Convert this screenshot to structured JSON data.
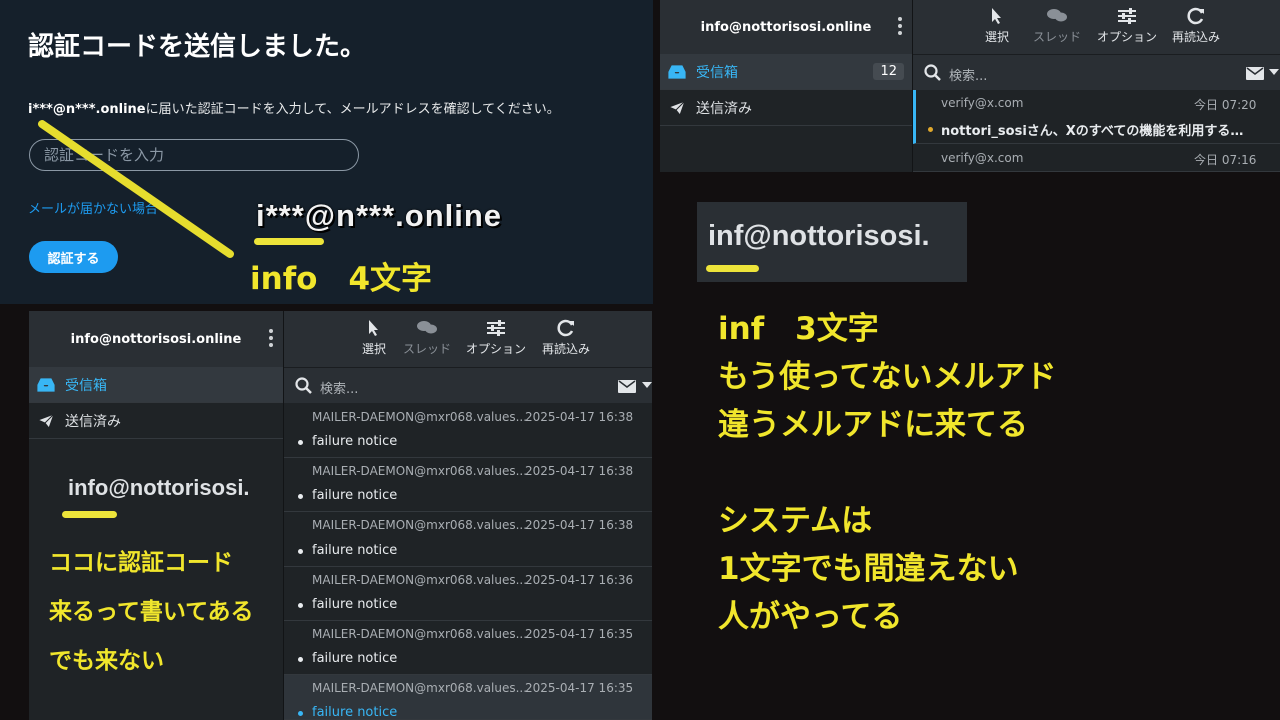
{
  "verify": {
    "title": "認証コードを送信しました。",
    "masked_email": "i***@n***.online",
    "desc_rest": "に届いた認証コードを入力して、メールアドレスを確認してください。",
    "input_placeholder": "認証コードを入力",
    "no_mail_link": "メールが届かない場合",
    "submit_label": "認証する",
    "zoom_email": "i***@n***.online",
    "annot_info": "info　4文字"
  },
  "mail_top": {
    "account": "info@nottorisosi.online",
    "folders": [
      {
        "label": "受信箱",
        "count": "12"
      },
      {
        "label": "送信済み"
      }
    ],
    "toolbar": [
      {
        "label": "選択",
        "icon": "cursor-icon"
      },
      {
        "label": "スレッド",
        "icon": "chat-icon"
      },
      {
        "label": "オプション",
        "icon": "sliders-icon"
      },
      {
        "label": "再読込み",
        "icon": "refresh-icon"
      }
    ],
    "search_placeholder": "検索...",
    "messages": [
      {
        "from": "verify@x.com",
        "date": "今日 07:20",
        "subject": "nottori_sosiさん、Xのすべての機能を利用する…"
      },
      {
        "from": "verify@x.com",
        "date": "今日 07:16",
        "subject": ""
      }
    ]
  },
  "mail_bottom": {
    "account": "info@nottorisosi.online",
    "folders": [
      {
        "label": "受信箱"
      },
      {
        "label": "送信済み"
      }
    ],
    "toolbar": [
      {
        "label": "選択",
        "icon": "cursor-icon"
      },
      {
        "label": "スレッド",
        "icon": "chat-icon"
      },
      {
        "label": "オプション",
        "icon": "sliders-icon"
      },
      {
        "label": "再読込み",
        "icon": "refresh-icon"
      }
    ],
    "search_placeholder": "検索...",
    "zoom_account": "info@nottorisosi.",
    "annot_lines": [
      "ココに認証コード",
      "来るって書いてある",
      "でも来ない"
    ],
    "messages": [
      {
        "from": "MAILER-DAEMON@mxr068.values...",
        "date": "2025-04-17 16:38",
        "subject": "failure notice"
      },
      {
        "from": "MAILER-DAEMON@mxr068.values...",
        "date": "2025-04-17 16:38",
        "subject": "failure notice"
      },
      {
        "from": "MAILER-DAEMON@mxr068.values...",
        "date": "2025-04-17 16:38",
        "subject": "failure notice"
      },
      {
        "from": "MAILER-DAEMON@mxr068.values...",
        "date": "2025-04-17 16:36",
        "subject": "failure notice"
      },
      {
        "from": "MAILER-DAEMON@mxr068.values...",
        "date": "2025-04-17 16:35",
        "subject": "failure notice"
      },
      {
        "from": "MAILER-DAEMON@mxr068.values...",
        "date": "2025-04-17 16:35",
        "subject": "failure notice"
      }
    ]
  },
  "right_annotation": {
    "zoom_account": "inf@nottorisosi.",
    "lines": [
      "inf　3文字",
      "もう使ってないメルアド",
      "違うメルアドに来てる",
      "",
      "システムは",
      "1文字でも間違えない",
      "人がやってる"
    ]
  },
  "colors": {
    "annotation": "#f1e62c",
    "accent": "#1d9bf0",
    "panel": "#15202b"
  }
}
